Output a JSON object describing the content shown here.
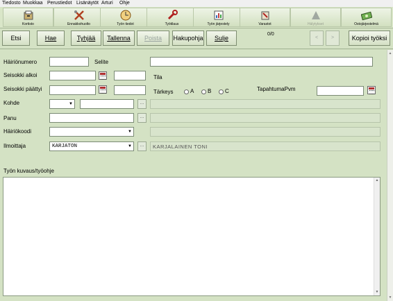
{
  "menu": {
    "items": [
      "Tiedosto",
      "Muokkaa",
      "Perustiedot",
      "Lisänäytöt",
      "Arturi",
      "Ohje"
    ]
  },
  "toolbar": {
    "buttons": [
      {
        "label": "Kortisto",
        "icon": "card-file-icon"
      },
      {
        "label": "Ennakkohuolto",
        "icon": "tools-icon"
      },
      {
        "label": "Työn tiedot",
        "icon": "clock-icon"
      },
      {
        "label": "Työtilaus",
        "icon": "wrench-icon"
      },
      {
        "label": "Työn järjestely",
        "icon": "calendar-chart-icon"
      },
      {
        "label": "Varastot",
        "icon": "warehouse-icon"
      },
      {
        "label": "Hälytykset",
        "icon": "warning-triangle-icon"
      },
      {
        "label": "Ostojärjestelmä",
        "icon": "money-icon"
      }
    ]
  },
  "actions": {
    "etsi": "Etsi",
    "hae": "Hae",
    "tyhjaa": "Tyhjää",
    "tallenna": "Tallenna",
    "poista": "Poista",
    "hakupohja": "Hakupohja",
    "sulje": "Sulje",
    "counter": "0/0",
    "prev": "<",
    "next": ">",
    "kopioi": "Kopioi työksi"
  },
  "form": {
    "hairionumero": "Häiriönumero",
    "selite": "Selite",
    "seisokki_alkoi": "Seisokki alkoi",
    "seisokki_paattyi": "Seisokki päättyi",
    "tila": "Tila",
    "tarkeys": "Tärkeys",
    "radio_a": "A",
    "radio_b": "B",
    "radio_c": "C",
    "tapahtumapvm": "TapahtumaPvm",
    "kohde": "Kohde",
    "panu": "Panu",
    "hairiokoodi": "Häiriökoodi",
    "ilmoittaja": "Ilmoittaja",
    "ilmoittaja_value": "KARJATON",
    "ilmoittaja_name": "KARJALAINEN TONI",
    "ellipsis": "...",
    "tyon_kuvaus": "Työn kuvaus/työohje"
  }
}
